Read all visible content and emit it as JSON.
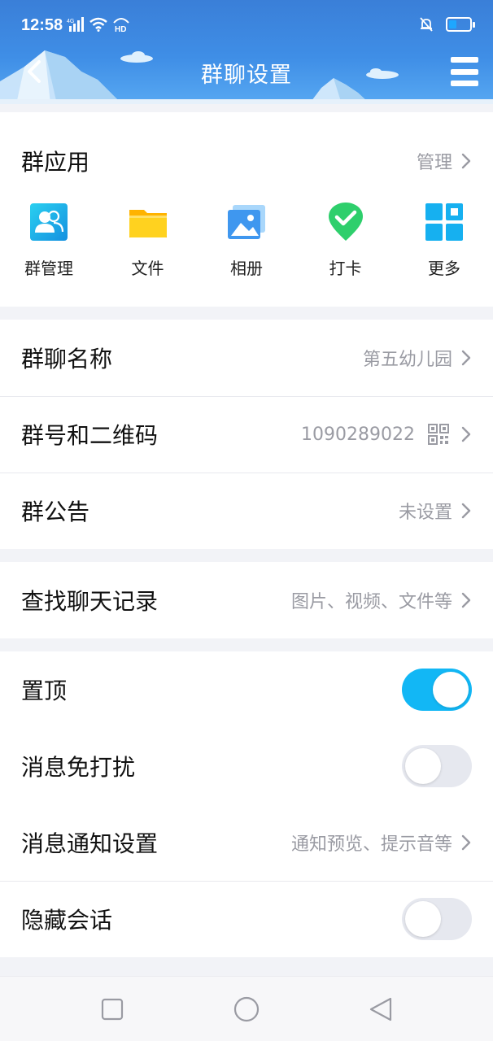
{
  "status_bar": {
    "time": "12:58",
    "network": "4G",
    "hd": "HD"
  },
  "header": {
    "title": "群聊设置",
    "back_icon": "chevron-left-icon",
    "menu_icon": "hamburger-menu-icon"
  },
  "group_apps": {
    "title": "群应用",
    "manage_label": "管理",
    "items": [
      {
        "label": "群管理",
        "icon": "group-manage-icon",
        "color": "#1aa6e8"
      },
      {
        "label": "文件",
        "icon": "folder-icon",
        "color": "#ffc107"
      },
      {
        "label": "相册",
        "icon": "photo-album-icon",
        "color": "#3f97ef"
      },
      {
        "label": "打卡",
        "icon": "check-in-icon",
        "color": "#2ecf6c"
      },
      {
        "label": "更多",
        "icon": "more-grid-icon",
        "color": "#16b0f0"
      }
    ]
  },
  "group_info": {
    "name_label": "群聊名称",
    "name_value": "第五幼儿园",
    "number_label": "群号和二维码",
    "number_value": "1090289022",
    "notice_label": "群公告",
    "notice_value": "未设置"
  },
  "history": {
    "label": "查找聊天记录",
    "value": "图片、视频、文件等"
  },
  "settings": {
    "pin_label": "置顶",
    "pin_on": true,
    "dnd_label": "消息免打扰",
    "dnd_on": false,
    "notify_label": "消息通知设置",
    "notify_value": "通知预览、提示音等",
    "hide_label": "隐藏会话",
    "hide_on": false
  },
  "colors": {
    "header_blue": "#3f8ee6",
    "toggle_on": "#12b7f5",
    "toggle_off": "#e6e8ef"
  }
}
